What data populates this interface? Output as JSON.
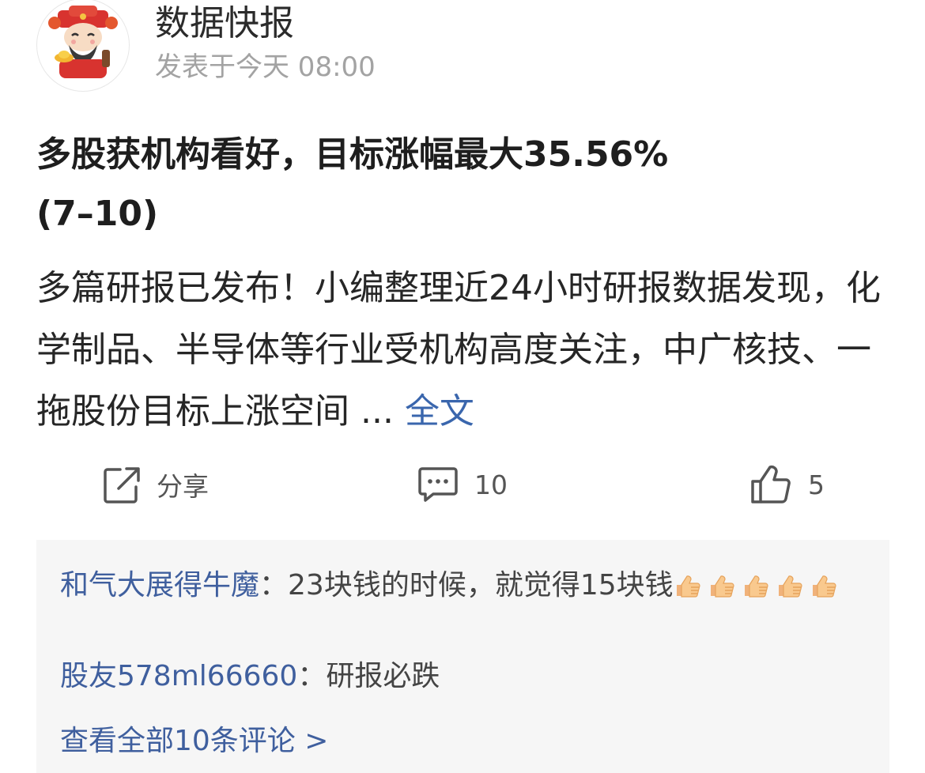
{
  "post": {
    "author": "数据快报",
    "time": "发表于今天 08:00",
    "title": "多股获机构看好，目标涨幅最大35.56%(7–10)",
    "summary": "多篇研报已发布！小编整理近24小时研报数据发现，化学制品、半导体等行业受机构高度关注，中广核技、一拖股份目标上涨空间 ... ",
    "more_label": "全文"
  },
  "actions": {
    "share": {
      "icon": "share-icon",
      "label": "分享"
    },
    "comment": {
      "icon": "comment-icon",
      "label": "10"
    },
    "like": {
      "icon": "thumbs-up-icon",
      "label": "5"
    }
  },
  "comments": {
    "items": [
      {
        "user": "和气大展得牛魔",
        "separator": "：",
        "text": "23块钱的时候，就觉得15块钱",
        "emoji": "thumbs-up-emoji",
        "emoji_count": 5
      },
      {
        "user": "股友578ml66660",
        "separator": "：",
        "text": "研报必跌"
      }
    ],
    "view_all": "查看全部10条评论 >"
  },
  "colors": {
    "link": "#3a66ad",
    "username": "#3f5f9e",
    "comment_bg": "#f6f6f6",
    "muted": "#a3a3a3"
  }
}
